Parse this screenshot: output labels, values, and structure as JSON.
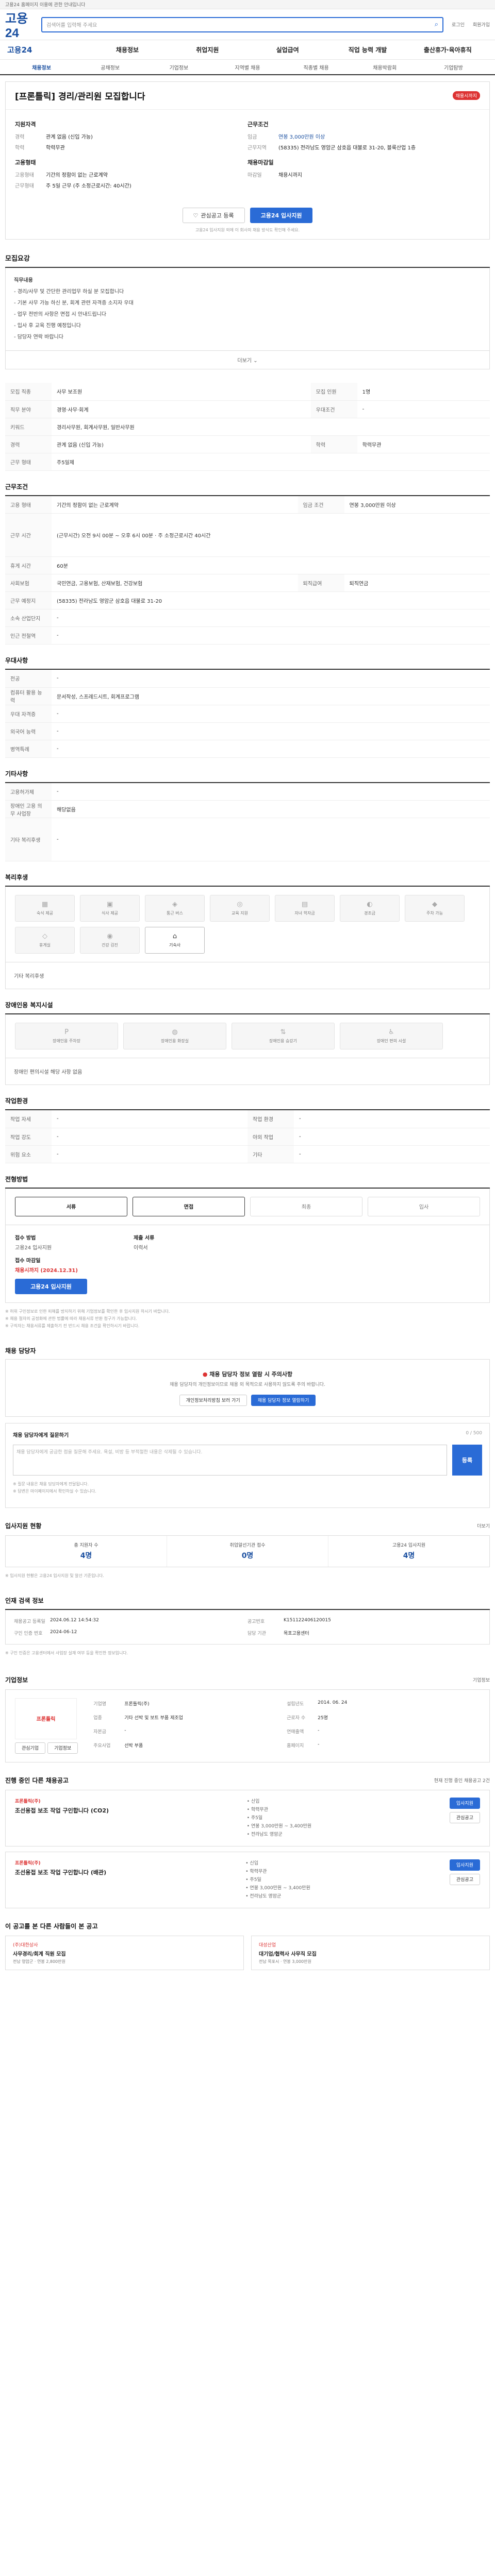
{
  "topbar": {
    "notice": "고용24 홈페이지 이용에 관한 안내입니다"
  },
  "header": {
    "logo": "고용24",
    "search_placeholder": "검색어를 입력해 주세요",
    "util_links": [
      "로그인",
      "회원가입"
    ]
  },
  "gnb": [
    "고용24",
    "채용정보",
    "취업지원",
    "실업급여",
    "직업 능력 개발",
    "출산휴가·육아휴직"
  ],
  "subnav": {
    "items": [
      "채용정보",
      "공채정보",
      "기업정보",
      "지역별 채용",
      "직종별 채용",
      "채용박람회",
      "기업탐방"
    ],
    "active_index": 0
  },
  "job": {
    "title": "[프론틀릭] 경리/관리원 모집합니다",
    "badge": "채용시까지",
    "left": [
      {
        "k": "지원자격",
        "v": ""
      },
      {
        "k": "경력",
        "v": "관계 없음 (신입 가능)"
      },
      {
        "k": "학력",
        "v": "학력무관"
      },
      {
        "k": "고용형태",
        "v": ""
      },
      {
        "k": "고용형태",
        "v": "기간의 정함이 없는 근로계약"
      },
      {
        "k": "근무형태",
        "v": "주 5일 근무 (주 소정근로시간: 40시간)"
      }
    ],
    "right": [
      {
        "k": "근무조건",
        "v": ""
      },
      {
        "k": "임금",
        "v": "연봉 3,000만원 이상"
      },
      {
        "k": "근무지역",
        "v": "(58335) 전라남도 영암군 삼호읍 대불로 31-20, 블룩산업 1층"
      },
      {
        "k": "채용마감일",
        "v": ""
      },
      {
        "k": "마감일",
        "v": "채용시까지"
      }
    ],
    "headings": {
      "left_a": "지원자격",
      "left_b": "고용형태",
      "right_a": "근무조건",
      "right_b": "채용마감일"
    },
    "btn_save": "관심공고 등록",
    "btn_apply": "고용24 입사지원",
    "note": "고용24 입사지원 외에 이 회사의 채용 방식도 확인해 주세요."
  },
  "sections": {
    "job_content": "모집요강",
    "recruit_conditions": "근무조건",
    "preference": "우대사항",
    "others": "기타사항",
    "welfare": "복리후생",
    "disability": "장애인용 복지시설",
    "work_env": "작업환경",
    "process": "전형방법",
    "manager": "채용 담당자",
    "applicants": "입사지원 현황",
    "agency": "기업 정보",
    "more_jobs": "진행 중인 다른 채용공고",
    "recommended": "이 공고를 본 다른 사람들이 본 공고"
  },
  "job_desc": {
    "lines": [
      "직무내용",
      "- 경리/사무 및 간단한 관리업무 하실 분 모집합니다",
      "- 기본 사무 가능 하신 분, 회계 관련 자격증 소지자 우대",
      "- 업무 전반의 사항은 면접 시 안내드립니다",
      "- 입사 후 교육 진행 예정입니다",
      "- 담당자 연락 바랍니다"
    ],
    "more": "더보기"
  },
  "conditions_a": [
    {
      "k": "모집 직종",
      "v": "사무 보조원"
    },
    {
      "k": "모집 인원",
      "v": "1명"
    },
    {
      "k": "직무 분야",
      "v": "경영·사무·회계"
    },
    {
      "k": "우대조건",
      "v": "-"
    },
    {
      "k": "키워드",
      "v": "경리사무원, 회계사무원, 일반사무원"
    },
    {
      "k": "경력",
      "v": "관계 없음 (신입 가능)"
    },
    {
      "k": "학력",
      "v": "학력무관"
    },
    {
      "k": "근무 형태",
      "v": "주5일제"
    }
  ],
  "conditions_b": [
    {
      "k": "고용 형태",
      "v": "기간의 정함이 없는 근로계약"
    },
    {
      "k": "임금 조건",
      "v": "연봉 3,000만원 이상"
    },
    {
      "k": "근무 시간",
      "v": "(근무시간) 오전 9시 00분 ~ 오후 6시 00분 · 주 소정근로시간 40시간"
    },
    {
      "k": "휴게 시간",
      "v": "60분"
    },
    {
      "k": "사회보험",
      "v": "국민연금, 고용보험, 산재보험, 건강보험"
    },
    {
      "k": "퇴직급여",
      "v": "퇴직연금"
    },
    {
      "k": "근무 예정지",
      "v": "(58335) 전라남도 영암군 삼호읍 대불로 31-20"
    },
    {
      "k": "소속 산업단지",
      "v": "-"
    },
    {
      "k": "인근 전철역",
      "v": "-"
    }
  ],
  "pref": [
    {
      "k": "전공",
      "v": "-"
    },
    {
      "k": "컴퓨터 활용 능력",
      "v": "문서작성, 스프레드시트, 회계프로그램"
    },
    {
      "k": "우대 자격증",
      "v": "-"
    },
    {
      "k": "외국어 능력",
      "v": "-"
    },
    {
      "k": "병역특례",
      "v": "-"
    }
  ],
  "others": [
    {
      "k": "고용허가제",
      "v": "-"
    },
    {
      "k": "장애인 고용 의무 사업장",
      "v": "해당없음"
    },
    {
      "k": "기타 복리후생",
      "v": "-"
    }
  ],
  "welfare": [
    {
      "icon": "▦",
      "label": "숙식 제공",
      "on": false
    },
    {
      "icon": "▣",
      "label": "식사 제공",
      "on": false
    },
    {
      "icon": "◈",
      "label": "통근 버스",
      "on": false
    },
    {
      "icon": "◎",
      "label": "교육 지원",
      "on": false
    },
    {
      "icon": "▤",
      "label": "자녀 학자금",
      "on": false
    },
    {
      "icon": "◐",
      "label": "경조금",
      "on": false
    },
    {
      "icon": "◆",
      "label": "주차 가능",
      "on": false
    },
    {
      "icon": "◇",
      "label": "휴게실",
      "on": false
    },
    {
      "icon": "◉",
      "label": "건강 검진",
      "on": false
    },
    {
      "icon": "⌂",
      "label": "기숙사",
      "on": true
    }
  ],
  "welfare_etc": "기타 복리후생",
  "disability": {
    "items": [
      "장애인용 주차장",
      "장애인용 화장실",
      "장애인용 승강기",
      "장애인 편의 시설"
    ],
    "note": "장애인 편의시설 해당 사항 없음"
  },
  "workenv": [
    {
      "k": "작업 자세",
      "v": "-",
      "k2": "작업 환경",
      "v2": "-"
    },
    {
      "k": "작업 강도",
      "v": "-",
      "k2": "야외 작업",
      "v2": "-"
    },
    {
      "k": "위험 요소",
      "v": "-",
      "k2": "기타",
      "v2": "-"
    }
  ],
  "process": {
    "steps": [
      "서류",
      "면접",
      "최종",
      "입사"
    ],
    "active": [
      true,
      true,
      false,
      false
    ],
    "apply_method_label": "접수 방법",
    "apply_method": "고용24 입사지원",
    "apply_deadline_label": "접수 마감일",
    "apply_deadline": "채용시까지 (2024.12.31)",
    "docs_label": "제출 서류",
    "docs": "이력서",
    "btn": "고용24 입사지원",
    "notes": [
      "※ 허위 구인정보로 인한 피해를 방지하기 위해 기업정보를 확인한 후 입사지원 하시기 바랍니다.",
      "※ 채용 절차의 공정화에 관한 법률에 따라 채용서류 반환 청구가 가능합니다.",
      "※ 구직자는 채용서류를 제출하기 전 반드시 채용 조건을 확인하시기 바랍니다."
    ]
  },
  "manager": {
    "alert_title": "채용 담당자 정보 열람 시 주의사항",
    "alert_text": "채용 담당자의 개인정보이므로 채용 외 목적으로 사용하지 않도록 주의 바랍니다.",
    "btn_a": "개인정보처리방침 보러 가기",
    "btn_b": "채용 담당자 정보 열람하기",
    "q_title": "채용 담당자에게 질문하기",
    "q_count": "0 / 500",
    "q_placeholder": "채용 담당자에게 궁금한 점을 질문해 주세요. 욕설, 비방 등 부적절한 내용은 삭제될 수 있습니다.",
    "q_btn": "등록",
    "q_notes": [
      "※ 질문 내용은 채용 담당자에게 전달됩니다.",
      "※ 답변은 마이페이지에서 확인하실 수 있습니다."
    ]
  },
  "applicants": {
    "more": "더보기",
    "stats": [
      {
        "label": "총 지원자 수",
        "value": "4명"
      },
      {
        "label": "취업알선기관 접수",
        "value": "0명"
      },
      {
        "label": "고용24 입사지원",
        "value": "4명"
      }
    ],
    "note": "※ 입사지원 현황은 고용24 입사지원 및 알선 기준입니다."
  },
  "agency": {
    "head": "인재 검색 정보",
    "rows": [
      {
        "k": "채용공고 등록일",
        "v": "2024.06.12 14:54:32",
        "k2": "공고번호",
        "v2": "K151122406120015"
      },
      {
        "k": "구인 인증 번호",
        "v": "2024-06-12",
        "k2": "담당 기관",
        "v2": "목포고용센터"
      }
    ],
    "notes": [
      "※ 구인 인증은 고용센터에서 사업장 실재 여부 등을 확인한 정보입니다."
    ]
  },
  "company": {
    "title": "기업정보",
    "more": "기업정보",
    "logo_text": "프론틀릭",
    "btn_a": "관심기업",
    "btn_b": "기업정보",
    "rows": [
      {
        "k": "기업명",
        "v": "프론틀릭(주)"
      },
      {
        "k": "설립년도",
        "v": "2014. 06. 24"
      },
      {
        "k": "업종",
        "v": "기타 선박 및 보트 부품 제조업"
      },
      {
        "k": "근로자 수",
        "v": "25명"
      },
      {
        "k": "자본금",
        "v": "-"
      },
      {
        "k": "연매출액",
        "v": "-"
      },
      {
        "k": "주요사업",
        "v": "선박 부품"
      },
      {
        "k": "홈페이지",
        "v": "-"
      }
    ]
  },
  "more_jobs": {
    "note": "현재 진행 중인 채용공고 2건",
    "items": [
      {
        "company": "프론틀릭(주)",
        "title": "조선용접 보조 작업 구인합니다 (CO2)",
        "meta": [
          "• 신입",
          "• 학력무관",
          "• 주5일",
          "• 연봉 3,000만원 ~ 3,400만원",
          "• 전라남도 영암군"
        ],
        "btn_a": "입사지원",
        "btn_b": "관심공고"
      },
      {
        "company": "프론틀릭(주)",
        "title": "조선용접 보조 작업 구인합니다 (배관)",
        "meta": [
          "• 신입",
          "• 학력무관",
          "• 주5일",
          "• 연봉 3,000만원 ~ 3,400만원",
          "• 전라남도 영암군"
        ],
        "btn_a": "입사지원",
        "btn_b": "관심공고"
      }
    ]
  },
  "recommended": [
    {
      "company": "(주)대한상사",
      "title": "사무경리/회계 직원 모집",
      "meta": "전남 영암군 · 연봉 2,800만원"
    },
    {
      "company": "대성산업",
      "title": "대기업/협력사 사무직 모집",
      "meta": "전남 목포시 · 연봉 3,000만원"
    }
  ]
}
